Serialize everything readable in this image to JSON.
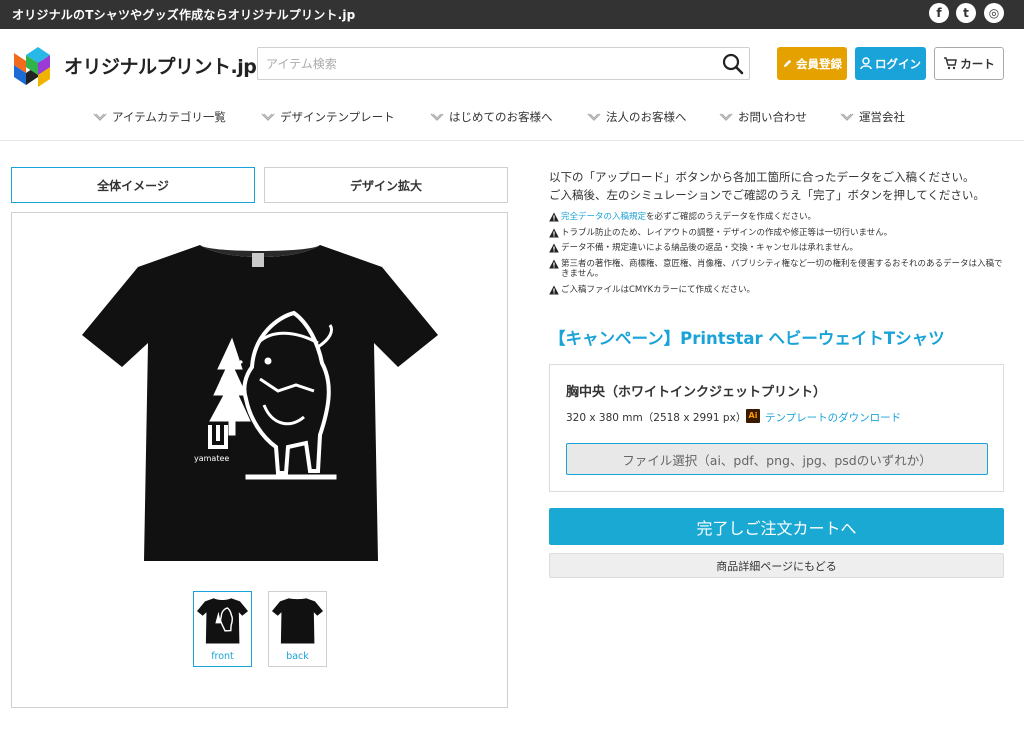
{
  "topbar": {
    "title": "オリジナルのTシャツやグッズ作成ならオリジナルプリント.jp",
    "social": [
      {
        "icon": "facebook-icon",
        "glyph": "f"
      },
      {
        "icon": "twitter-icon",
        "glyph": "t"
      },
      {
        "icon": "instagram-icon",
        "glyph": "◎"
      }
    ]
  },
  "header": {
    "logo_text": "オリジナルプリント.jp",
    "search_placeholder": "アイテム検索",
    "register_label": "会員登録",
    "login_label": "ログイン",
    "cart_label": "カート"
  },
  "nav": {
    "items": [
      {
        "label": "アイテムカテゴリ一覧"
      },
      {
        "label": "デザインテンプレート"
      },
      {
        "label": "はじめてのお客様へ"
      },
      {
        "label": "法人のお客様へ"
      },
      {
        "label": "お問い合わせ"
      },
      {
        "label": "運営会社"
      }
    ]
  },
  "preview": {
    "tabs": [
      {
        "label": "全体イメージ",
        "active": true
      },
      {
        "label": "デザイン拡大",
        "active": false
      }
    ],
    "brand_text": "yamatee",
    "thumbnails": [
      {
        "label": "front",
        "active": true
      },
      {
        "label": "back",
        "active": false
      }
    ]
  },
  "instructions": {
    "intro_line1": "以下の「アップロード」ボタンから各加工箇所に合ったデータをご入稿ください。",
    "intro_line2": "ご入稿後、左のシミュレーションでご確認のうえ「完了」ボタンを押してください。",
    "notes": [
      {
        "link": "完全データの入稿規定",
        "text": "を必ずご確認のうえデータを作成ください。"
      },
      {
        "link": "",
        "text": "トラブル防止のため、レイアウトの調整・デザインの作成や修正等は一切行いません。"
      },
      {
        "link": "",
        "text": "データ不備・規定違いによる納品後の返品・交換・キャンセルは承れません。"
      },
      {
        "link": "",
        "text": "第三者の著作権、商標権、意匠権、肖像権、パブリシティ権など一切の権利を侵害するおそれのあるデータは入稿できません。"
      },
      {
        "link": "",
        "text": "ご入稿ファイルはCMYKカラーにて作成ください。"
      }
    ]
  },
  "product": {
    "title": "【キャンペーン】Printstar ヘビーウェイトTシャツ",
    "print_area": "胸中央（ホワイトインクジェットプリント）",
    "size_text": "320 x 380 mm（2518 x 2991 px）",
    "ai_badge": "Ai",
    "template_link": "テンプレートのダウンロード",
    "file_button": "ファイル選択（ai、pdf、png、jpg、psdのいずれか）",
    "complete_button": "完了しご注文カートへ",
    "back_button": "商品詳細ページにもどる"
  },
  "colors": {
    "accent": "#1aa3d9",
    "register": "#e5a100",
    "topbar": "#333333",
    "shirt": "#111111"
  }
}
